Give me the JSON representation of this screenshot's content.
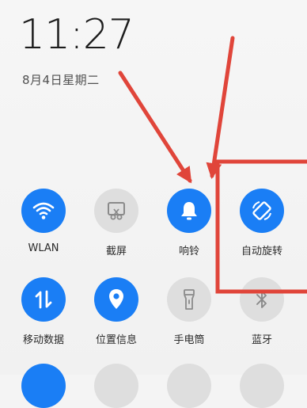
{
  "status": {
    "time": "11:27",
    "date": "8月4日星期二"
  },
  "quick_settings": {
    "row1": [
      {
        "label": "WLAN",
        "state": "on",
        "icon": "wifi-icon"
      },
      {
        "label": "截屏",
        "state": "off",
        "icon": "screenshot-icon"
      },
      {
        "label": "响铃",
        "state": "on",
        "icon": "bell-icon"
      },
      {
        "label": "自动旋转",
        "state": "on",
        "icon": "auto-rotate-icon"
      }
    ],
    "row2": [
      {
        "label": "移动数据",
        "state": "on",
        "icon": "mobile-data-icon"
      },
      {
        "label": "位置信息",
        "state": "on",
        "icon": "location-icon"
      },
      {
        "label": "手电筒",
        "state": "off",
        "icon": "flashlight-icon"
      },
      {
        "label": "蓝牙",
        "state": "off",
        "icon": "bluetooth-icon"
      }
    ]
  },
  "colors": {
    "active": "#1a7ef5",
    "inactive": "#dedede",
    "annotation": "#e0453a"
  }
}
